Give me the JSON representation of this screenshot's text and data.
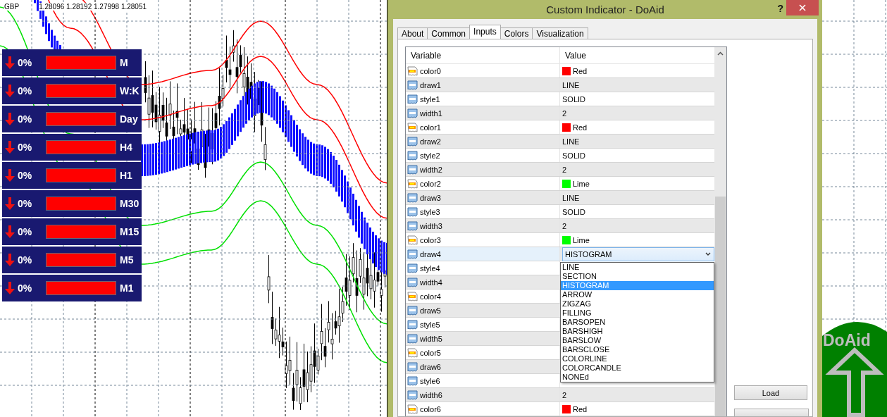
{
  "chart": {
    "symbol": "GBP",
    "ohlc": "1.28096 1.28192 1.27998 1.28051"
  },
  "strength_panel": [
    {
      "percent": "0%",
      "label": "M"
    },
    {
      "percent": "0%",
      "label": "W:K"
    },
    {
      "percent": "0%",
      "label": "Day"
    },
    {
      "percent": "0%",
      "label": "H4"
    },
    {
      "percent": "0%",
      "label": "H1"
    },
    {
      "percent": "0%",
      "label": "M30"
    },
    {
      "percent": "0%",
      "label": "M15"
    },
    {
      "percent": "0%",
      "label": "M5"
    },
    {
      "percent": "0%",
      "label": "M1"
    }
  ],
  "dialog": {
    "title": "Custom Indicator - DoAid",
    "help": "?",
    "tabs": [
      {
        "label": "About",
        "selected": false
      },
      {
        "label": "Common",
        "selected": false
      },
      {
        "label": "Inputs",
        "selected": true
      },
      {
        "label": "Colors",
        "selected": false
      },
      {
        "label": "Visualization",
        "selected": false
      }
    ],
    "columns": [
      "Variable",
      "Value"
    ],
    "rows": [
      {
        "name": "color0",
        "kind": "color",
        "value": "Red",
        "color": "#ff0000",
        "selected": false
      },
      {
        "name": "draw1",
        "kind": "number",
        "value": "LINE",
        "selected": false
      },
      {
        "name": "style1",
        "kind": "number",
        "value": "SOLID",
        "selected": false
      },
      {
        "name": "width1",
        "kind": "number",
        "value": "2",
        "selected": false
      },
      {
        "name": "color1",
        "kind": "color",
        "value": "Red",
        "color": "#ff0000",
        "selected": false
      },
      {
        "name": "draw2",
        "kind": "number",
        "value": "LINE",
        "selected": false
      },
      {
        "name": "style2",
        "kind": "number",
        "value": "SOLID",
        "selected": false
      },
      {
        "name": "width2",
        "kind": "number",
        "value": "2",
        "selected": false
      },
      {
        "name": "color2",
        "kind": "color",
        "value": "Lime",
        "color": "#00ff00",
        "selected": false
      },
      {
        "name": "draw3",
        "kind": "number",
        "value": "LINE",
        "selected": false
      },
      {
        "name": "style3",
        "kind": "number",
        "value": "SOLID",
        "selected": false
      },
      {
        "name": "width3",
        "kind": "number",
        "value": "2",
        "selected": false
      },
      {
        "name": "color3",
        "kind": "color",
        "value": "Lime",
        "color": "#00ff00",
        "selected": false
      },
      {
        "name": "draw4",
        "kind": "number",
        "value": "HISTOGRAM",
        "selected": true
      },
      {
        "name": "style4",
        "kind": "number",
        "selected": false
      },
      {
        "name": "width4",
        "kind": "number",
        "selected": false
      },
      {
        "name": "color4",
        "kind": "color",
        "selected": false
      },
      {
        "name": "draw5",
        "kind": "number",
        "selected": false
      },
      {
        "name": "style5",
        "kind": "number",
        "selected": false
      },
      {
        "name": "width5",
        "kind": "number",
        "selected": false
      },
      {
        "name": "color5",
        "kind": "color",
        "selected": false
      },
      {
        "name": "draw6",
        "kind": "number",
        "selected": false
      },
      {
        "name": "style6",
        "kind": "number",
        "selected": false
      },
      {
        "name": "width6",
        "kind": "number",
        "value": "2",
        "selected": false
      },
      {
        "name": "color6",
        "kind": "color",
        "value": "Red",
        "color": "#ff0000",
        "selected": false
      }
    ],
    "dropdown": [
      {
        "label": "LINE",
        "selected": false
      },
      {
        "label": "SECTION",
        "selected": false
      },
      {
        "label": "HISTOGRAM",
        "selected": true
      },
      {
        "label": "ARROW",
        "selected": false
      },
      {
        "label": "ZIGZAG",
        "selected": false
      },
      {
        "label": "FILLING",
        "selected": false
      },
      {
        "label": "BARSOPEN",
        "selected": false
      },
      {
        "label": "BARSHIGH",
        "selected": false
      },
      {
        "label": "BARSLOW",
        "selected": false
      },
      {
        "label": "BARSCLOSE",
        "selected": false
      },
      {
        "label": "COLORLINE",
        "selected": false
      },
      {
        "label": "COLORCANDLE",
        "selected": false
      },
      {
        "label": "NONEd",
        "selected": false
      }
    ],
    "buttons": [
      "Load"
    ]
  },
  "logo": {
    "text": "DoAid"
  }
}
